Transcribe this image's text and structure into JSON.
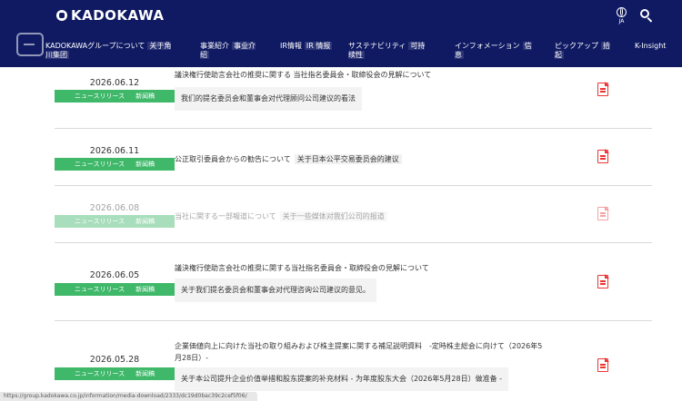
{
  "header": {
    "logo": "KADOKAWA",
    "lang_label": "JA",
    "nav": [
      {
        "label": "KADOKAWAグループについて",
        "tr": "关于角川集团"
      },
      {
        "label": "事業紹介",
        "tr": "事业介绍"
      },
      {
        "label": "IR情報",
        "tr": "IR 情报"
      },
      {
        "label": "サステナビリティ",
        "tr": "可持续性"
      },
      {
        "label": "インフォメーション",
        "tr": "信息"
      },
      {
        "label": "ピックアップ",
        "tr": "拾起"
      },
      {
        "label": "K-Insight",
        "tr": ""
      }
    ]
  },
  "news": [
    {
      "date": "2026.06.12",
      "tag": "ニュースリリース",
      "tag_tr": "新闻稿",
      "title": "議決権行使助言会社の推奨に関する 当社指名委員会・取締役会の見解について",
      "title_tr": "",
      "box": "我们的提名委员会和董事会对代理顾问公司建议的看法"
    },
    {
      "date": "2026.06.11",
      "tag": "ニュースリリース",
      "tag_tr": "新闻稿",
      "title": "公正取引委員会からの勧告について",
      "title_tr": "关于日本公平交易委员会的建议",
      "box": ""
    },
    {
      "date": "2026.06.08",
      "tag": "ニュースリリース",
      "tag_tr": "新闻稿",
      "title": "当社に関する一部報道について",
      "title_tr": "关于一些媒体对我们公司的报道",
      "box": ""
    },
    {
      "date": "2026.06.05",
      "tag": "ニュースリリース",
      "tag_tr": "新闻稿",
      "title": "議決権行使助言会社の推奨に関する当社指名委員会・取締役会の見解について",
      "title_tr": "",
      "box": "关于我们提名委员会和董事会对代理咨询公司建议的意见。"
    },
    {
      "date": "2026.05.28",
      "tag": "ニュースリリース",
      "tag_tr": "新闻稿",
      "title": "企業価値向上に向けた当社の取り組みおよび株主提案に関する補足説明資料　-定時株主総会に向けて（2026年5月28日）-",
      "title_tr": "",
      "box": "关于本公司提升企业价值举措和股东提案的补充材料 - 为年度股东大会（2026年5月28日）做准备 -"
    }
  ],
  "status_url": "https://group.kadokawa.co.jp/information/media-download/2333/dc19d0bac39c2cef5f06/",
  "colors": {
    "header_bg": "#0f1a63",
    "tag_bg": "#3fb86a",
    "pdf": "#ee3333"
  }
}
